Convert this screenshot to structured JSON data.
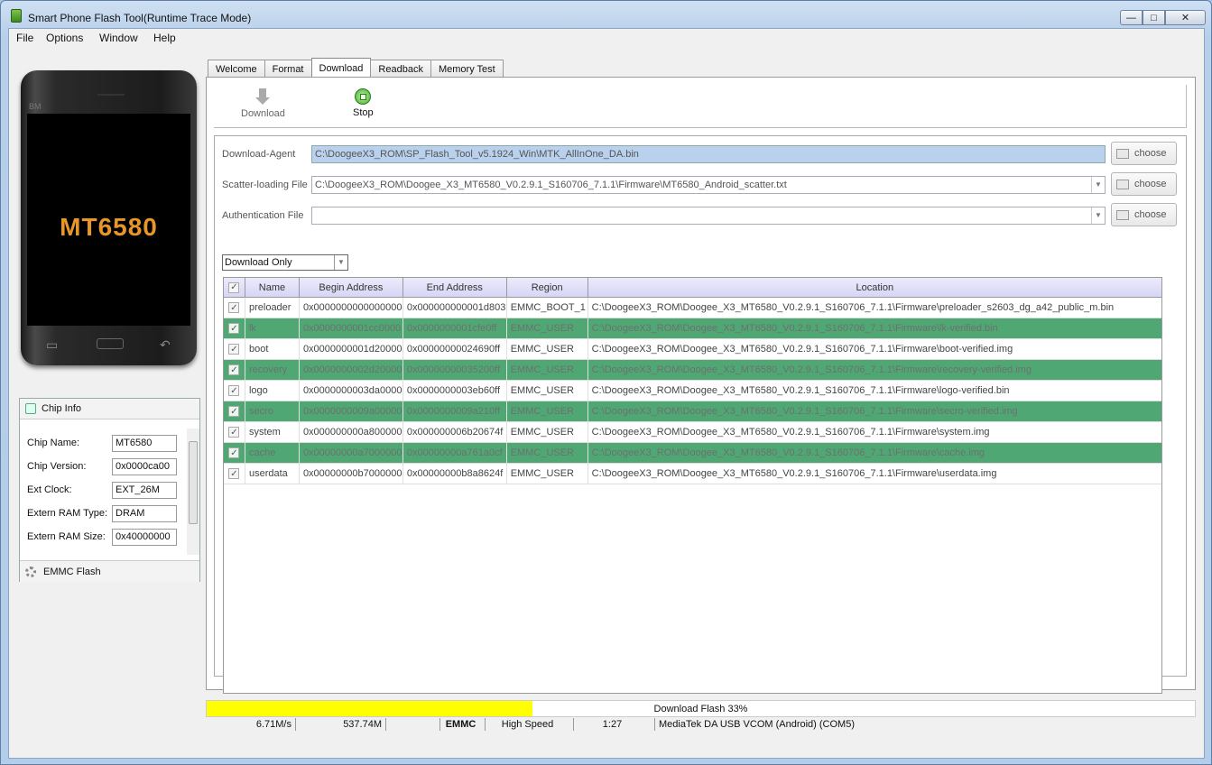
{
  "window": {
    "title": "Smart Phone Flash Tool(Runtime Trace Mode)"
  },
  "menu": [
    "File",
    "Options",
    "Window",
    "Help"
  ],
  "phone": {
    "bm": "BM",
    "chip": "MT6580"
  },
  "chip_info": {
    "title": "Chip Info",
    "rows": [
      {
        "label": "Chip Name:",
        "value": "MT6580"
      },
      {
        "label": "Chip Version:",
        "value": "0x0000ca00"
      },
      {
        "label": "Ext Clock:",
        "value": "EXT_26M"
      },
      {
        "label": "Extern RAM Type:",
        "value": "DRAM"
      },
      {
        "label": "Extern RAM Size:",
        "value": "0x40000000"
      }
    ]
  },
  "emmc_flash": "EMMC Flash",
  "tabs": [
    "Welcome",
    "Format",
    "Download",
    "Readback",
    "Memory Test"
  ],
  "active_tab": "Download",
  "toolbar": {
    "download": "Download",
    "stop": "Stop"
  },
  "form": {
    "download_agent": {
      "label": "Download-Agent",
      "value": "C:\\DoogeeX3_ROM\\SP_Flash_Tool_v5.1924_Win\\MTK_AllInOne_DA.bin"
    },
    "scatter": {
      "label": "Scatter-loading File",
      "value": "C:\\DoogeeX3_ROM\\Doogee_X3_MT6580_V0.2.9.1_S160706_7.1.1\\Firmware\\MT6580_Android_scatter.txt"
    },
    "auth": {
      "label": "Authentication File",
      "value": ""
    },
    "choose": "choose",
    "mode": "Download Only"
  },
  "table": {
    "headers": [
      "Name",
      "Begin Address",
      "End Address",
      "Region",
      "Location"
    ],
    "rows": [
      {
        "name": "preloader",
        "begin": "0x0000000000000000",
        "end": "0x000000000001d803",
        "region": "EMMC_BOOT_1",
        "location": "C:\\DoogeeX3_ROM\\Doogee_X3_MT6580_V0.2.9.1_S160706_7.1.1\\Firmware\\preloader_s2603_dg_a42_public_m.bin",
        "highlight": false
      },
      {
        "name": "lk",
        "begin": "0x0000000001cc0000",
        "end": "0x0000000001cfe0ff",
        "region": "EMMC_USER",
        "location": "C:\\DoogeeX3_ROM\\Doogee_X3_MT6580_V0.2.9.1_S160706_7.1.1\\Firmware\\lk-verified.bin",
        "highlight": true
      },
      {
        "name": "boot",
        "begin": "0x0000000001d20000",
        "end": "0x00000000024690ff",
        "region": "EMMC_USER",
        "location": "C:\\DoogeeX3_ROM\\Doogee_X3_MT6580_V0.2.9.1_S160706_7.1.1\\Firmware\\boot-verified.img",
        "highlight": false
      },
      {
        "name": "recovery",
        "begin": "0x0000000002d20000",
        "end": "0x00000000035200ff",
        "region": "EMMC_USER",
        "location": "C:\\DoogeeX3_ROM\\Doogee_X3_MT6580_V0.2.9.1_S160706_7.1.1\\Firmware\\recovery-verified.img",
        "highlight": true
      },
      {
        "name": "logo",
        "begin": "0x0000000003da0000",
        "end": "0x0000000003eb60ff",
        "region": "EMMC_USER",
        "location": "C:\\DoogeeX3_ROM\\Doogee_X3_MT6580_V0.2.9.1_S160706_7.1.1\\Firmware\\logo-verified.bin",
        "highlight": false
      },
      {
        "name": "secro",
        "begin": "0x0000000009a00000",
        "end": "0x0000000009a210ff",
        "region": "EMMC_USER",
        "location": "C:\\DoogeeX3_ROM\\Doogee_X3_MT6580_V0.2.9.1_S160706_7.1.1\\Firmware\\secro-verified.img",
        "highlight": true
      },
      {
        "name": "system",
        "begin": "0x000000000a800000",
        "end": "0x000000006b20674f",
        "region": "EMMC_USER",
        "location": "C:\\DoogeeX3_ROM\\Doogee_X3_MT6580_V0.2.9.1_S160706_7.1.1\\Firmware\\system.img",
        "highlight": false
      },
      {
        "name": "cache",
        "begin": "0x00000000a7000000",
        "end": "0x00000000a761a0cf",
        "region": "EMMC_USER",
        "location": "C:\\DoogeeX3_ROM\\Doogee_X3_MT6580_V0.2.9.1_S160706_7.1.1\\Firmware\\cache.img",
        "highlight": true
      },
      {
        "name": "userdata",
        "begin": "0x00000000b7000000",
        "end": "0x00000000b8a8624f",
        "region": "EMMC_USER",
        "location": "C:\\DoogeeX3_ROM\\Doogee_X3_MT6580_V0.2.9.1_S160706_7.1.1\\Firmware\\userdata.img",
        "highlight": false
      }
    ]
  },
  "progress": {
    "text": "Download Flash 33%",
    "fraction": 0.33,
    "color": "#ffff00"
  },
  "status": {
    "speed": "6.71M/s",
    "size": "537.74M",
    "blank": "",
    "storage": "EMMC",
    "mode": "High Speed",
    "time": "1:27",
    "port": "MediaTek DA USB VCOM (Android) (COM5)"
  },
  "colors": {
    "highlight_row": "#4fa874",
    "header": "#d6d6f6"
  }
}
